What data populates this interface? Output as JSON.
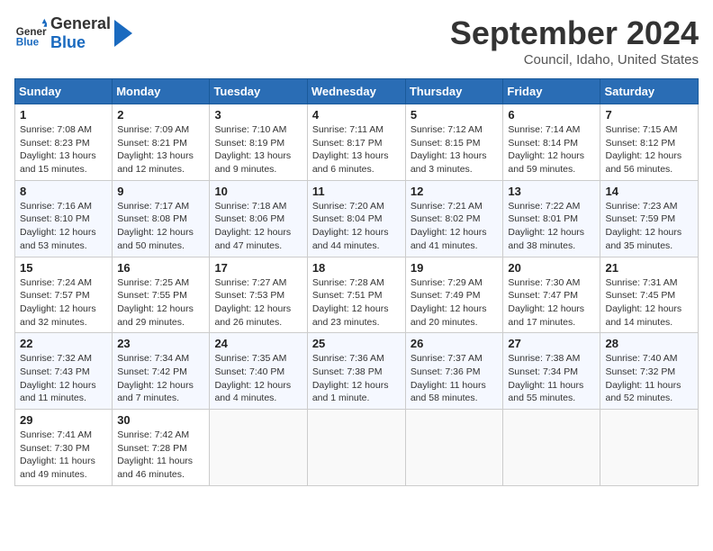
{
  "header": {
    "logo_general": "General",
    "logo_blue": "Blue",
    "month_title": "September 2024",
    "location": "Council, Idaho, United States"
  },
  "days_of_week": [
    "Sunday",
    "Monday",
    "Tuesday",
    "Wednesday",
    "Thursday",
    "Friday",
    "Saturday"
  ],
  "weeks": [
    [
      {
        "day": "1",
        "info": "Sunrise: 7:08 AM\nSunset: 8:23 PM\nDaylight: 13 hours\nand 15 minutes."
      },
      {
        "day": "2",
        "info": "Sunrise: 7:09 AM\nSunset: 8:21 PM\nDaylight: 13 hours\nand 12 minutes."
      },
      {
        "day": "3",
        "info": "Sunrise: 7:10 AM\nSunset: 8:19 PM\nDaylight: 13 hours\nand 9 minutes."
      },
      {
        "day": "4",
        "info": "Sunrise: 7:11 AM\nSunset: 8:17 PM\nDaylight: 13 hours\nand 6 minutes."
      },
      {
        "day": "5",
        "info": "Sunrise: 7:12 AM\nSunset: 8:15 PM\nDaylight: 13 hours\nand 3 minutes."
      },
      {
        "day": "6",
        "info": "Sunrise: 7:14 AM\nSunset: 8:14 PM\nDaylight: 12 hours\nand 59 minutes."
      },
      {
        "day": "7",
        "info": "Sunrise: 7:15 AM\nSunset: 8:12 PM\nDaylight: 12 hours\nand 56 minutes."
      }
    ],
    [
      {
        "day": "8",
        "info": "Sunrise: 7:16 AM\nSunset: 8:10 PM\nDaylight: 12 hours\nand 53 minutes."
      },
      {
        "day": "9",
        "info": "Sunrise: 7:17 AM\nSunset: 8:08 PM\nDaylight: 12 hours\nand 50 minutes."
      },
      {
        "day": "10",
        "info": "Sunrise: 7:18 AM\nSunset: 8:06 PM\nDaylight: 12 hours\nand 47 minutes."
      },
      {
        "day": "11",
        "info": "Sunrise: 7:20 AM\nSunset: 8:04 PM\nDaylight: 12 hours\nand 44 minutes."
      },
      {
        "day": "12",
        "info": "Sunrise: 7:21 AM\nSunset: 8:02 PM\nDaylight: 12 hours\nand 41 minutes."
      },
      {
        "day": "13",
        "info": "Sunrise: 7:22 AM\nSunset: 8:01 PM\nDaylight: 12 hours\nand 38 minutes."
      },
      {
        "day": "14",
        "info": "Sunrise: 7:23 AM\nSunset: 7:59 PM\nDaylight: 12 hours\nand 35 minutes."
      }
    ],
    [
      {
        "day": "15",
        "info": "Sunrise: 7:24 AM\nSunset: 7:57 PM\nDaylight: 12 hours\nand 32 minutes."
      },
      {
        "day": "16",
        "info": "Sunrise: 7:25 AM\nSunset: 7:55 PM\nDaylight: 12 hours\nand 29 minutes."
      },
      {
        "day": "17",
        "info": "Sunrise: 7:27 AM\nSunset: 7:53 PM\nDaylight: 12 hours\nand 26 minutes."
      },
      {
        "day": "18",
        "info": "Sunrise: 7:28 AM\nSunset: 7:51 PM\nDaylight: 12 hours\nand 23 minutes."
      },
      {
        "day": "19",
        "info": "Sunrise: 7:29 AM\nSunset: 7:49 PM\nDaylight: 12 hours\nand 20 minutes."
      },
      {
        "day": "20",
        "info": "Sunrise: 7:30 AM\nSunset: 7:47 PM\nDaylight: 12 hours\nand 17 minutes."
      },
      {
        "day": "21",
        "info": "Sunrise: 7:31 AM\nSunset: 7:45 PM\nDaylight: 12 hours\nand 14 minutes."
      }
    ],
    [
      {
        "day": "22",
        "info": "Sunrise: 7:32 AM\nSunset: 7:43 PM\nDaylight: 12 hours\nand 11 minutes."
      },
      {
        "day": "23",
        "info": "Sunrise: 7:34 AM\nSunset: 7:42 PM\nDaylight: 12 hours\nand 7 minutes."
      },
      {
        "day": "24",
        "info": "Sunrise: 7:35 AM\nSunset: 7:40 PM\nDaylight: 12 hours\nand 4 minutes."
      },
      {
        "day": "25",
        "info": "Sunrise: 7:36 AM\nSunset: 7:38 PM\nDaylight: 12 hours\nand 1 minute."
      },
      {
        "day": "26",
        "info": "Sunrise: 7:37 AM\nSunset: 7:36 PM\nDaylight: 11 hours\nand 58 minutes."
      },
      {
        "day": "27",
        "info": "Sunrise: 7:38 AM\nSunset: 7:34 PM\nDaylight: 11 hours\nand 55 minutes."
      },
      {
        "day": "28",
        "info": "Sunrise: 7:40 AM\nSunset: 7:32 PM\nDaylight: 11 hours\nand 52 minutes."
      }
    ],
    [
      {
        "day": "29",
        "info": "Sunrise: 7:41 AM\nSunset: 7:30 PM\nDaylight: 11 hours\nand 49 minutes."
      },
      {
        "day": "30",
        "info": "Sunrise: 7:42 AM\nSunset: 7:28 PM\nDaylight: 11 hours\nand 46 minutes."
      },
      {
        "day": "",
        "info": ""
      },
      {
        "day": "",
        "info": ""
      },
      {
        "day": "",
        "info": ""
      },
      {
        "day": "",
        "info": ""
      },
      {
        "day": "",
        "info": ""
      }
    ]
  ]
}
